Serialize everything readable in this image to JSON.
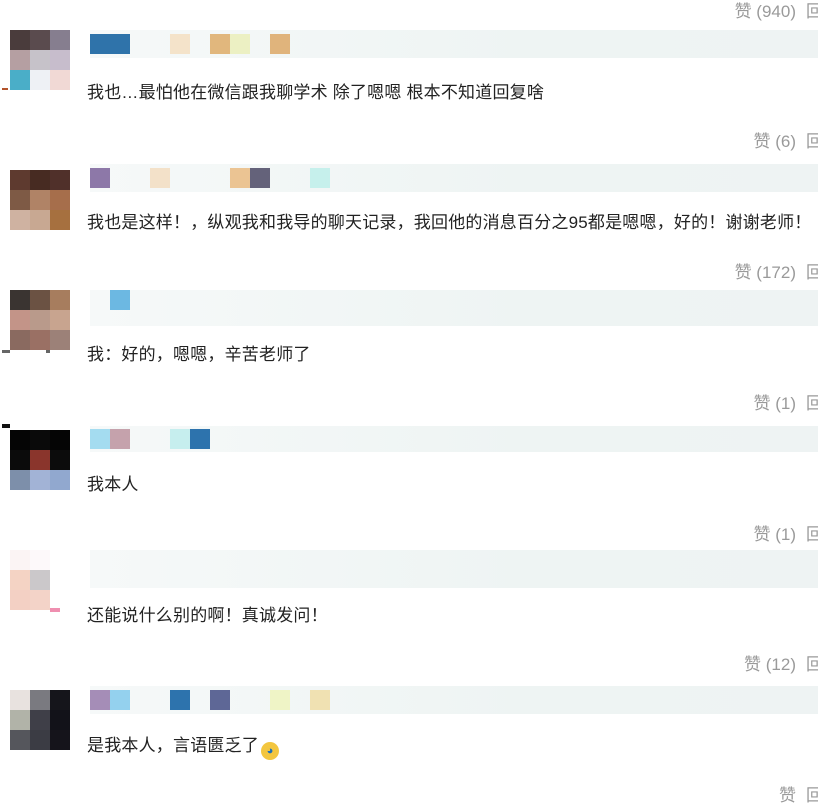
{
  "top_action": {
    "like_label": "赞 (940)",
    "reply_label": "回"
  },
  "comments": [
    {
      "text": "我也…最怕他在微信跟我聊学术 除了嗯嗯 根本不知道回复啥",
      "like_label": "赞 (6)",
      "reply_label": "回"
    },
    {
      "text": "我也是这样！，纵观我和我导的聊天记录，我回他的消息百分之95都是嗯嗯，好的！谢谢老师！",
      "like_label": "赞 (172)",
      "reply_label": "回"
    },
    {
      "text": "我：好的，嗯嗯，辛苦老师了",
      "like_label": "赞 (1)",
      "reply_label": "回"
    },
    {
      "text": "我本人",
      "like_label": "赞 (1)",
      "reply_label": "回"
    },
    {
      "text": "还能说什么别的啊！真诚发问！",
      "like_label": "赞 (12)",
      "reply_label": "回"
    },
    {
      "text": "是我本人，言语匮乏了",
      "emoji": "loudly-crying-face-icon",
      "like_label": "赞",
      "reply_label": "回"
    }
  ],
  "colors": {
    "like_text": "#9a9a9a",
    "comment_text": "#222222",
    "name_placeholder_bg": "#eef4f3"
  }
}
